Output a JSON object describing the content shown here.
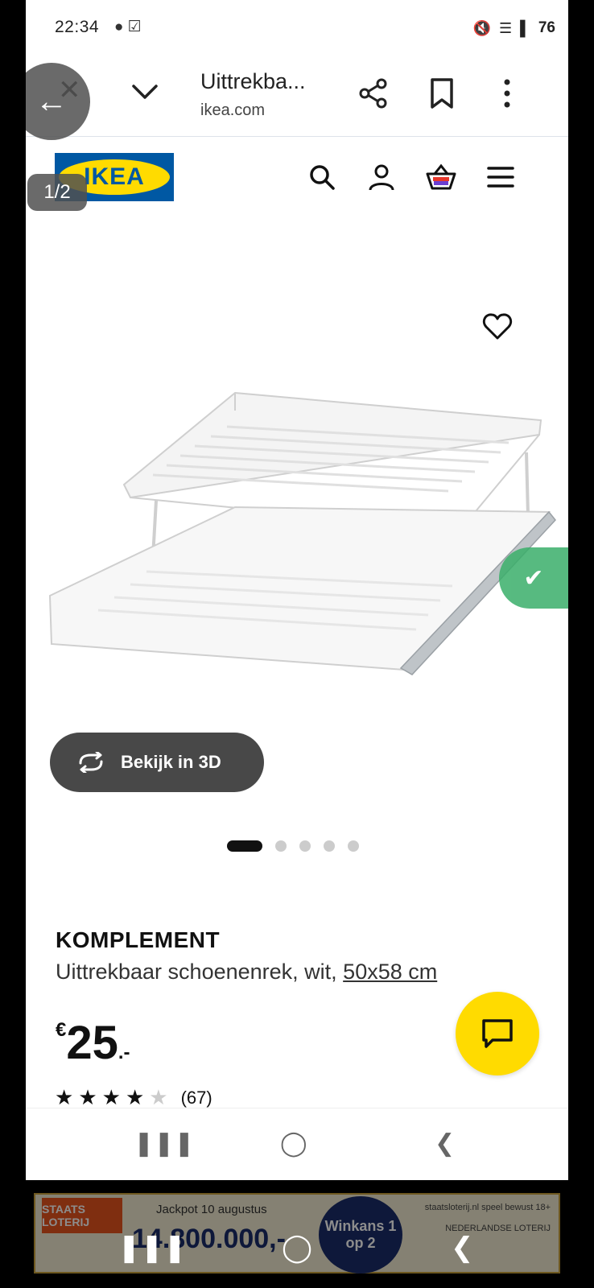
{
  "status": {
    "time": "22:34",
    "battery": "76"
  },
  "browser": {
    "tab_title": "Uittrekba...",
    "url": "ikea.com"
  },
  "overlay": {
    "page_counter": "1/2"
  },
  "site": {
    "logo_text": "IKEA"
  },
  "product": {
    "view_3d_label": "Bekijk in 3D",
    "name": "KOMPLEMENT",
    "description": "Uittrekbaar schoenenrek, wit, ",
    "size": "50x58 cm",
    "price_currency": "€",
    "price_value": "25",
    "price_suffix": ".-",
    "rating_stars": 4,
    "rating_max": 5,
    "rating_count": "(67)",
    "image_count": 5,
    "active_image": 1
  },
  "ad": {
    "brand": "STAATS LOTERIJ",
    "headline": "Jackpot 10 augustus",
    "amount": "14.800.000,-",
    "badge": "Winkans 1 op 2",
    "fine_print": "staatsloterij.nl speel bewust 18+",
    "sponsor": "NEDERLANDSE LOTERIJ"
  },
  "colors": {
    "ikea_blue": "#0058a3",
    "ikea_yellow": "#ffdb00",
    "badge_green": "#3aaf6a"
  }
}
